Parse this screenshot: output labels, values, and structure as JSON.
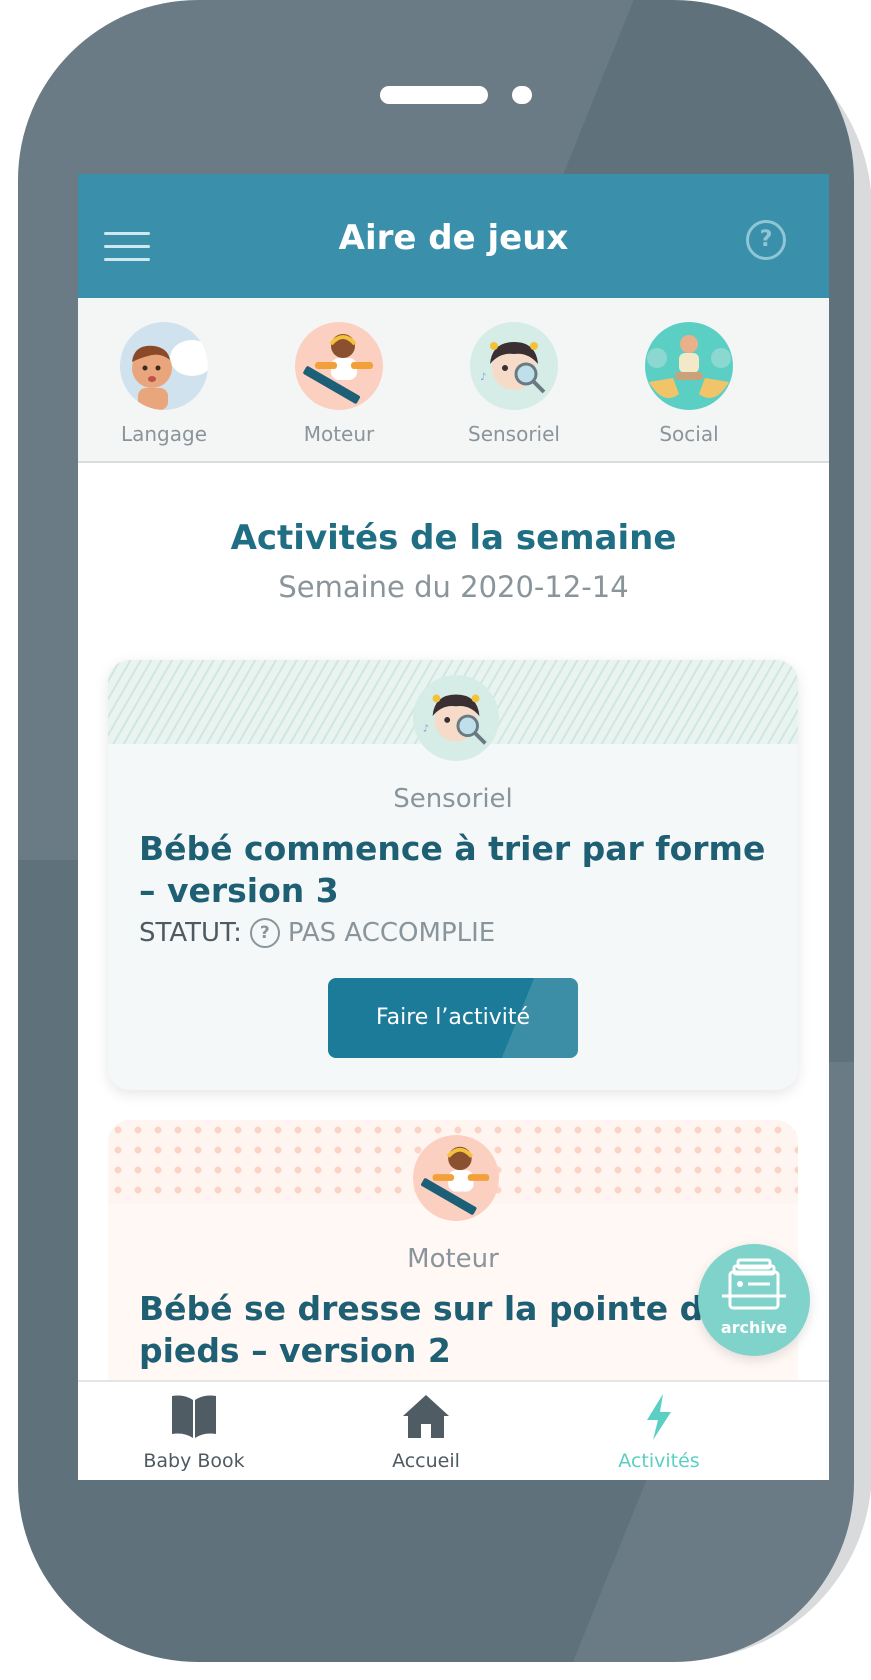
{
  "header": {
    "title": "Aire de jeux"
  },
  "categories": [
    {
      "label": "Langage",
      "icon": "baby-talking-icon"
    },
    {
      "label": "Moteur",
      "icon": "baby-crawling-icon"
    },
    {
      "label": "Sensoriel",
      "icon": "baby-magnifier-icon"
    },
    {
      "label": "Social",
      "icon": "babies-circle-icon"
    }
  ],
  "section": {
    "title": "Activités de la semaine",
    "subtitle": "Semaine du 2020-12-14"
  },
  "activities": [
    {
      "category": "Sensoriel",
      "title": "Bébé commence à trier par forme – version 3",
      "status_label": "STATUT:",
      "status_value": "PAS ACCOMPLIE",
      "action_label": "Faire l’activité"
    },
    {
      "category": "Moteur",
      "title": "Bébé se dresse sur la pointe des pieds – version 2"
    }
  ],
  "fab": {
    "label": "archive"
  },
  "tabs": [
    {
      "label": "Baby Book",
      "icon": "book-icon"
    },
    {
      "label": "Accueil",
      "icon": "home-icon"
    },
    {
      "label": "Activités",
      "icon": "lightning-icon"
    }
  ],
  "colors": {
    "header": "#3a8fab",
    "primary_text": "#1f6e84",
    "button": "#1b7b98",
    "accent": "#5ccfc4",
    "muted": "#8a959b",
    "device": "#5f727c"
  }
}
